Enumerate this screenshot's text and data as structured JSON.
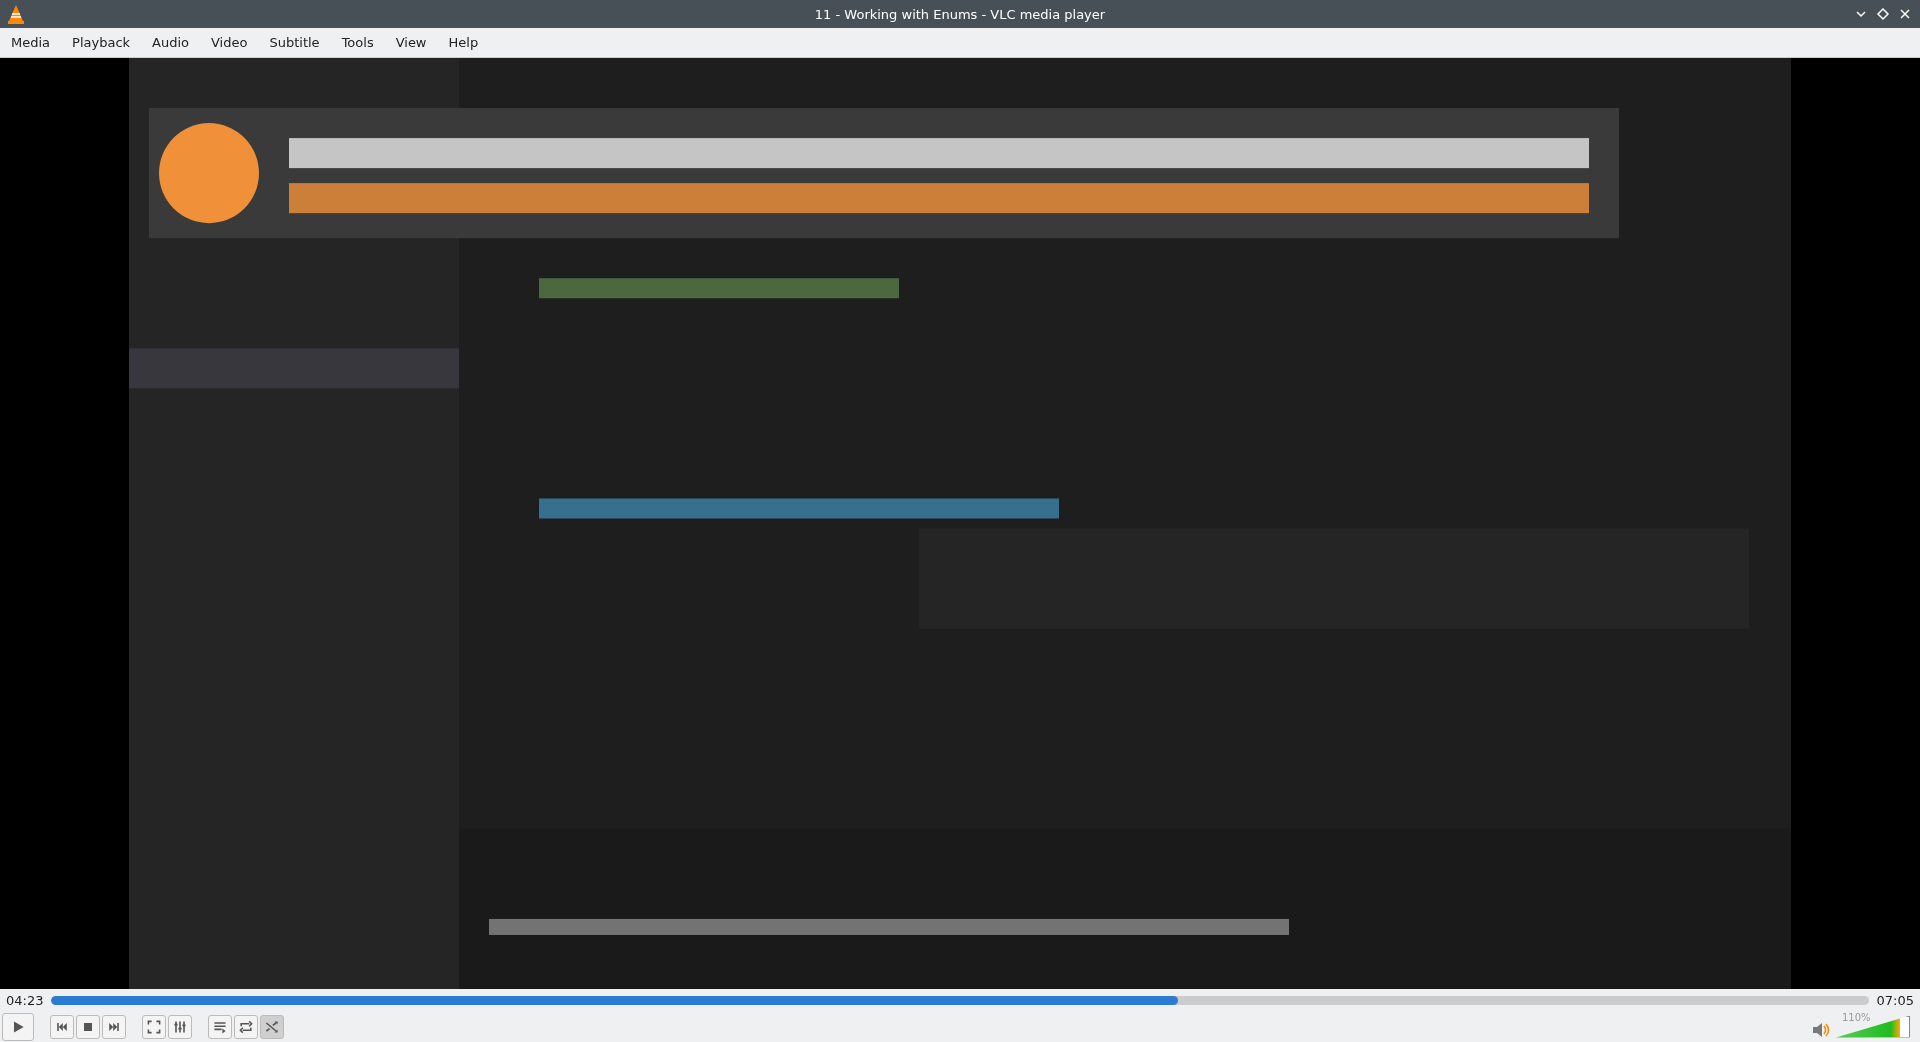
{
  "window": {
    "title": "11 - Working with Enums - VLC media player"
  },
  "menu": [
    "Media",
    "Playback",
    "Audio",
    "Video",
    "Subtitle",
    "Tools",
    "View",
    "Help"
  ],
  "video": {
    "kind": "picture"
  },
  "seek": {
    "elapsed": "04:23",
    "total": "07:05",
    "level": 0.62
  },
  "controls": [
    {
      "kind": "play",
      "on": false
    },
    {
      "kind": "previous",
      "on": false
    },
    {
      "kind": "stop",
      "on": false
    },
    {
      "kind": "next",
      "on": false
    },
    {
      "kind": "fullscreen",
      "on": false
    },
    {
      "kind": "settings",
      "on": false
    },
    {
      "kind": "playlist",
      "on": false
    },
    {
      "kind": "loop",
      "on": false
    },
    {
      "kind": "shuffle",
      "on": true
    }
  ],
  "volume": {
    "reading": "110%",
    "level": 0.88
  }
}
